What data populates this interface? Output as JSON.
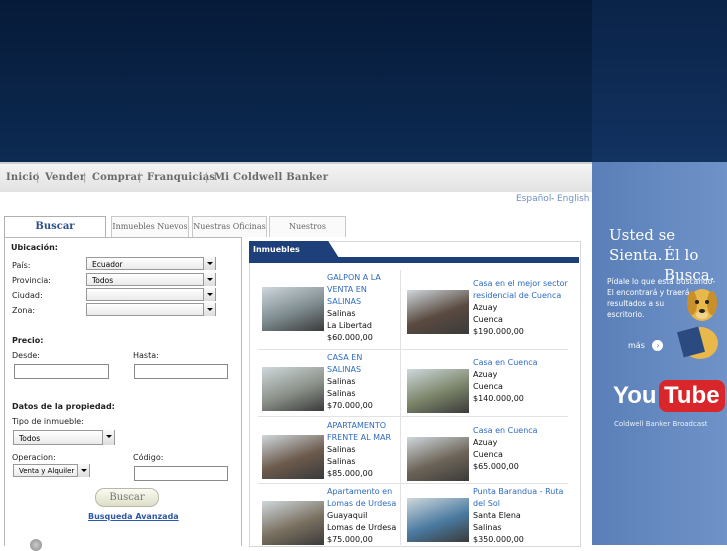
{
  "nav": {
    "items": [
      "Inicio",
      "Vender",
      "Comprar",
      "Franquicias",
      "Mi Coldwell Banker"
    ],
    "separator": "|"
  },
  "lang": {
    "es": "Español",
    "sep": "-",
    "en": "English"
  },
  "tabs": [
    "Buscar Inmuebles",
    "Inmuebles Nuevos",
    "Nuestras Oficinas",
    "Nuestros Asesores"
  ],
  "search": {
    "ubicacion_label": "Ubicación:",
    "pais_label": "País:",
    "pais_value": "Ecuador",
    "provincia_label": "Provincia:",
    "provincia_value": "Todos",
    "ciudad_label": "Ciudad:",
    "ciudad_value": "",
    "zona_label": "Zona:",
    "zona_value": "",
    "precio_label": "Precio:",
    "desde_label": "Desde:",
    "hasta_label": "Hasta:",
    "desde_value": "",
    "hasta_value": "",
    "datos_label": "Datos de la propiedad:",
    "tipo_label": "Tipo de inmueble:",
    "tipo_value": "Todos",
    "operacion_label": "Operacion:",
    "operacion_value": "Venta y Alquiler",
    "codigo_label": "Código:",
    "codigo_value": "",
    "buscar_label": "Buscar",
    "avanzada_label": "Busqueda Avanzada"
  },
  "recent": {
    "title": "Inmuebles Recientes",
    "cards": [
      {
        "title": [
          "GALPON A LA",
          "VENTA EN",
          "SALINAS"
        ],
        "lines": [
          "Salinas",
          "La Libertad",
          "$60.000,00"
        ],
        "thumb": "#7d8a8e"
      },
      {
        "title": [
          "Casa en el mejor sector",
          "residencial de Cuenca"
        ],
        "lines": [
          "Azuay",
          "Cuenca",
          "$190.000,00"
        ],
        "thumb": "#5a4a40"
      },
      {
        "title": [
          "CASA EN",
          "SALINAS"
        ],
        "lines": [
          "Salinas",
          "Salinas",
          "$70.000,00"
        ],
        "thumb": "#8a9088"
      },
      {
        "title": [
          "Casa en Cuenca"
        ],
        "lines": [
          "Azuay",
          "Cuenca",
          "$140.000,00"
        ],
        "thumb": "#7a8468"
      },
      {
        "title": [
          "APARTAMENTO",
          "FRENTE AL MAR"
        ],
        "lines": [
          "Salinas",
          "Salinas",
          "$85.000,00"
        ],
        "thumb": "#6c5a4c"
      },
      {
        "title": [
          "Casa en Cuenca"
        ],
        "lines": [
          "Azuay",
          "Cuenca",
          "$65.000,00"
        ],
        "thumb": "#6d6458"
      },
      {
        "title": [
          "Apartamento en",
          "Lomas de Urdesa"
        ],
        "lines": [
          "Guayaquil",
          "Lomas de Urdesa",
          "$75.000,00"
        ],
        "thumb": "#7a7060"
      },
      {
        "title": [
          "Punta Barandua - Ruta",
          "del Sol"
        ],
        "lines": [
          "Santa Elena",
          "Salinas",
          "$350.000,00"
        ],
        "thumb": "#4a7aa0"
      }
    ]
  },
  "ad": {
    "line1": "Usted se Sienta.",
    "line2": "Él lo Busca.",
    "body": [
      "Pídale lo que está buscando-",
      "El encontrará y traerá",
      "resultados a su",
      "escritorio."
    ],
    "mas": "más",
    "youtube_you": "You",
    "youtube_tube": "Tube",
    "youtube_sub": "Coldwell Banker Broadcast"
  },
  "colors": {
    "accent": "#1d3f7a",
    "link": "#2d6ac0",
    "header": "#0a2448",
    "side": "#6385bd"
  }
}
